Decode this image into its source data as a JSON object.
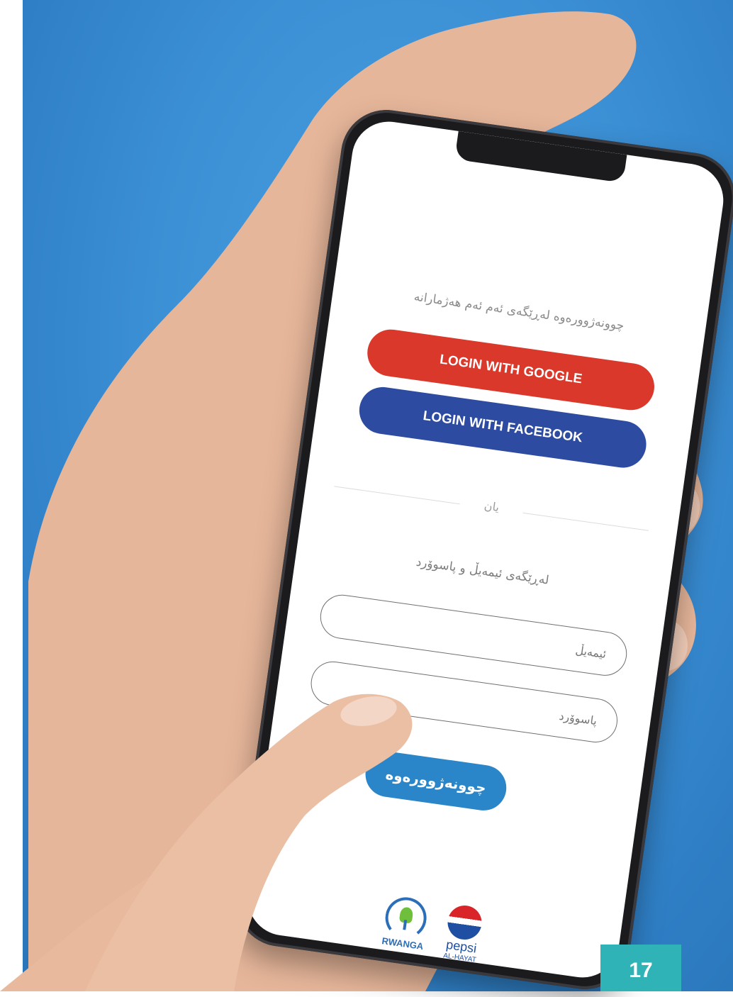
{
  "screen": {
    "intro_text": "چوونەژوورەوە لەڕێگەی ئەم ئەم هەژمارانە",
    "google_button_label": "LOGIN WITH GOOGLE",
    "facebook_button_label": "LOGIN WITH FACEBOOK",
    "divider_text": "یان",
    "email_password_text": "لەڕێگەی ئیمەیڵ و پاسوۆرد",
    "email_placeholder": "ئیمەیڵ",
    "password_placeholder": "پاسوۆرد",
    "submit_label": "چوونەژوورەوە",
    "logos": {
      "rwanga": "RWANGA",
      "pepsi": "pepsi",
      "pepsi_sub": "AL-HAYAT"
    }
  },
  "page_number": "17",
  "colors": {
    "background": "#3b8fd4",
    "google_button": "#d9382a",
    "facebook_button": "#2d4ba0",
    "submit_button": "#2a86c8",
    "page_badge": "#2fb3b7"
  }
}
